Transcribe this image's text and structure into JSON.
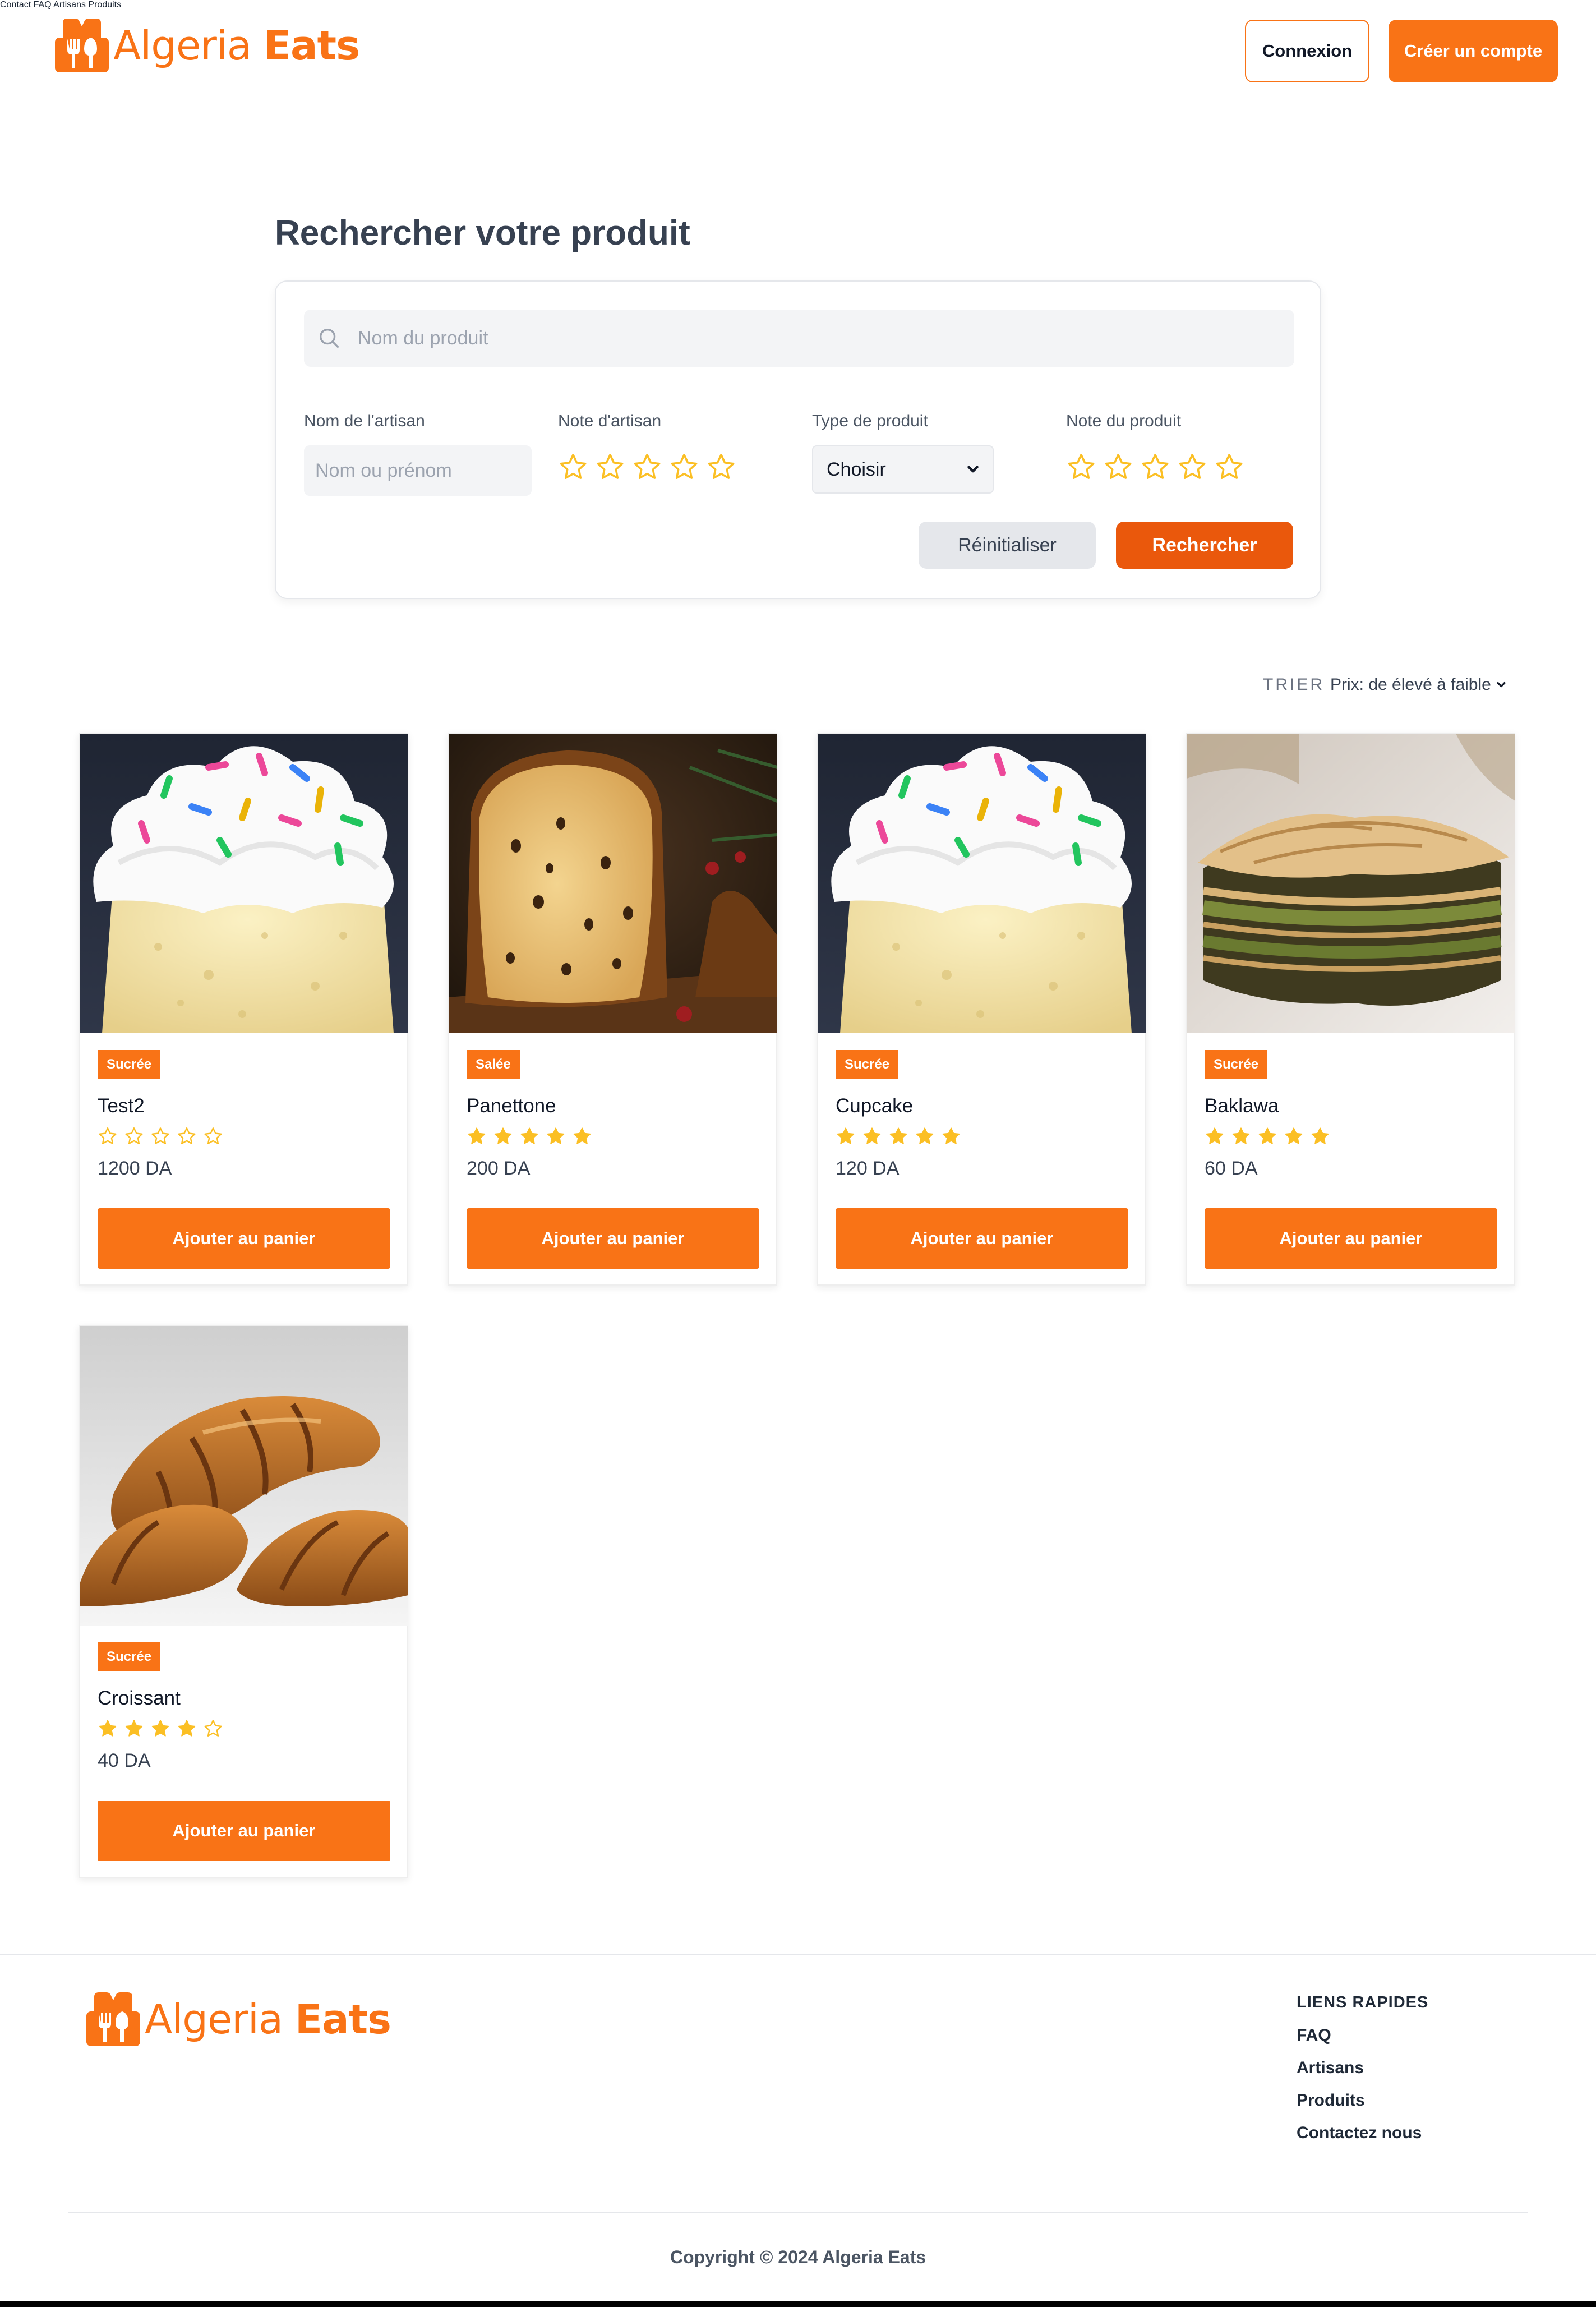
{
  "brand": {
    "name_regular": "Algeria ",
    "name_bold": "Eats",
    "color": "#f97316"
  },
  "nav": {
    "items": [
      "Contact",
      "FAQ",
      "Artisans",
      "Produits"
    ],
    "login": "Connexion",
    "signup": "Créer un compte"
  },
  "search": {
    "title": "Rechercher votre produit",
    "placeholder": "Nom du produit",
    "filters": {
      "artisan_label": "Nom de l'artisan",
      "artisan_placeholder": "Nom ou prénom",
      "artisan_rating_label": "Note d'artisan",
      "type_label": "Type de produit",
      "type_value": "Choisir",
      "product_rating_label": "Note du produit"
    },
    "reset": "Réinitialiser",
    "submit": "Rechercher"
  },
  "sort": {
    "label": "TRIER",
    "value": "Prix: de élevé à faible"
  },
  "products": [
    {
      "name": "Test2",
      "category": "Sucrée",
      "rating": 0,
      "price": "1200 DA",
      "image": "cupcake-photo",
      "button": "Ajouter au panier"
    },
    {
      "name": "Panettone",
      "category": "Salée",
      "rating": 5,
      "price": "200 DA",
      "image": "panettone-photo",
      "button": "Ajouter au panier"
    },
    {
      "name": "Cupcake",
      "category": "Sucrée",
      "rating": 5,
      "price": "120 DA",
      "image": "cupcake-photo",
      "button": "Ajouter au panier"
    },
    {
      "name": "Baklawa",
      "category": "Sucrée",
      "rating": 5,
      "price": "60 DA",
      "image": "baklawa-photo",
      "button": "Ajouter au panier"
    },
    {
      "name": "Croissant",
      "category": "Sucrée",
      "rating": 4,
      "price": "40 DA",
      "image": "croissant-photo",
      "button": "Ajouter au panier"
    }
  ],
  "footer": {
    "links_title": "LIENS RAPIDES",
    "links": [
      "FAQ",
      "Artisans",
      "Produits",
      "Contactez nous"
    ],
    "copyright": "Copyright © 2024  Algeria Eats"
  },
  "colors": {
    "accent": "#f97316",
    "accent_dark": "#ea580c",
    "star": "#fbbf24",
    "heading": "#374151"
  }
}
